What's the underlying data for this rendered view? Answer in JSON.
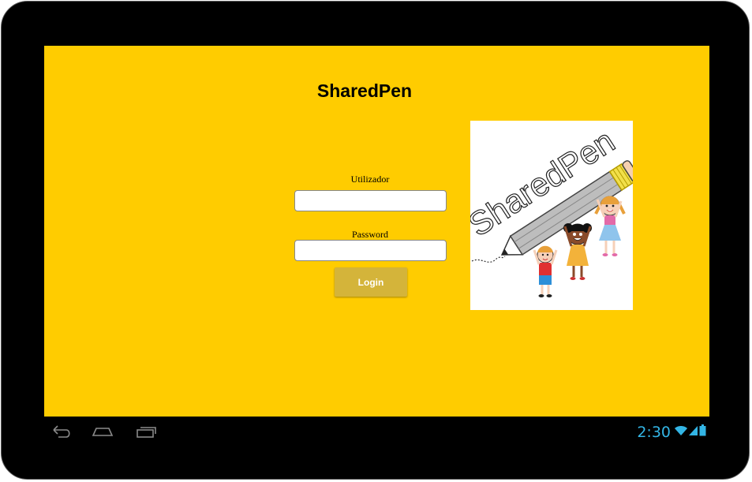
{
  "app": {
    "title": "SharedPen"
  },
  "login_form": {
    "username_label": "Utilizador",
    "username_value": "",
    "password_label": "Password",
    "password_value": "",
    "login_button_label": "Login"
  },
  "logo": {
    "text": "SharedPen",
    "icon": "pencil-with-children-logo"
  },
  "system_bar": {
    "time": "2:30",
    "nav_icons": [
      "back-icon",
      "home-icon",
      "recent-apps-icon"
    ],
    "status_icons": [
      "wifi-icon",
      "signal-icon",
      "battery-icon"
    ]
  },
  "colors": {
    "background": "#ffcc00",
    "button": "#d4b43a",
    "clock": "#33b5e5",
    "device_frame": "#000000"
  }
}
